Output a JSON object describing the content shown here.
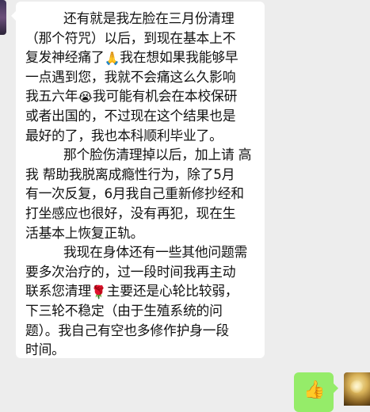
{
  "chat": {
    "incoming": {
      "lines": [
        "还有就是我左脸在三月份清理",
        "（那个符咒）以后，到现在基本上不",
        "复发神经痛了",
        "我在想如果我能够早",
        "一点遇到您，我就不会痛这么久影响",
        "我五六年",
        "我可能有机会在本校保研",
        "或者出国的，不过现在这个结果也是",
        "最好的了，我也本科顺利毕业了。",
        "那个脸伤清理掉以后，加上请 高",
        "我 帮助我脱离成瘾性行为，除了5月",
        "有一次反复，6月我自己重新修抄经和",
        "打坐感应也很好，没有再犯，现在生",
        "活基本上恢复正轨。",
        "我现在身体还有一些其他问题需",
        "要多次治疗的，过一段时间我再主动",
        "联系您清理",
        "主要还是心轮比较弱，",
        "下三轮不稳定（由于生殖系统的问",
        "题）。我自己有空也多修作护身一段",
        "时间。"
      ],
      "emojis": {
        "pray": "🙏",
        "crying": "😭",
        "rose": "🌹"
      }
    },
    "outgoing": {
      "emoji": "👍"
    }
  }
}
